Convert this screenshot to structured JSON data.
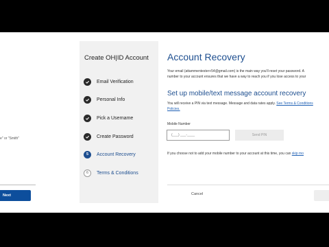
{
  "left_panel": {
    "hint_text": "e\" or \"Smith\"",
    "next_label": "Next"
  },
  "stepper": {
    "title": "Create OH|ID Account",
    "steps": [
      {
        "label": "Personal Info",
        "status": "done"
      },
      {
        "label": "Email Verification",
        "status": "done"
      },
      {
        "label": "Pick a Username",
        "status": "done"
      },
      {
        "label": "Create Password",
        "status": "done"
      },
      {
        "label": "Account Recovery",
        "status": "active",
        "number": "5"
      },
      {
        "label": "Terms & Conditions",
        "status": "todo",
        "number": "6"
      }
    ]
  },
  "main": {
    "title": "Account Recovery",
    "intro_line1": "Your email (attammentester+54@gmail.com) is the main way you'll reset your password. A",
    "intro_line2": "number to your account ensures that we have a way to reach you if you lose access to your",
    "section_title": "Set up mobile/text message account recovery",
    "pin_note": "You will receive a PIN via text message. Message and data rates apply.",
    "terms_link_part1": "See Terms & Conditions",
    "terms_link_part2": "Policies.",
    "mobile_label": "Mobile Number",
    "mobile_placeholder": "(___) ___-____",
    "send_pin_label": "Send PIN",
    "skip_note": "If you choose not to add your mobile number to your account at this time, you can",
    "skip_link": "skip mo",
    "cancel_label": "Cancel"
  },
  "colors": {
    "brand_blue": "#1d4e8f",
    "next_button": "#0d4e9c"
  }
}
